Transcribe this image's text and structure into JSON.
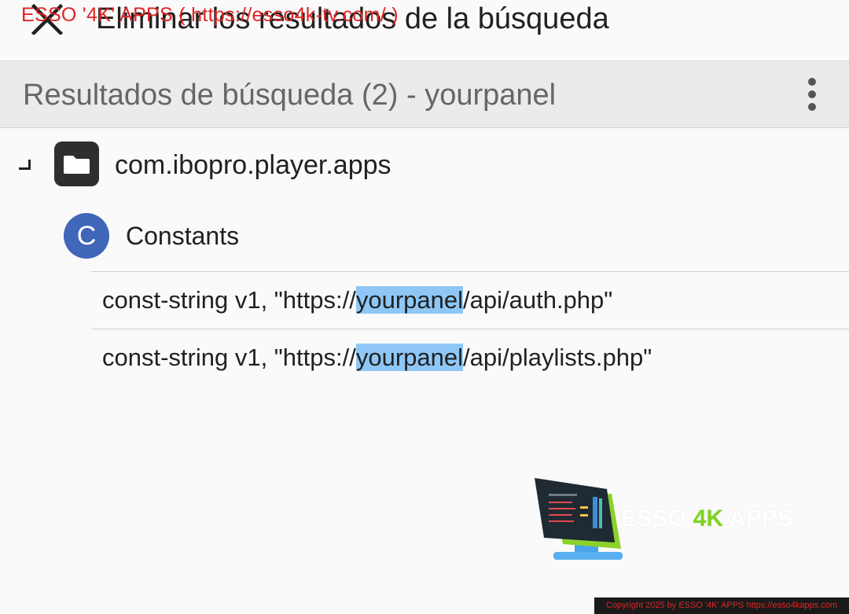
{
  "topbar": {
    "close_icon": "close-icon",
    "title": "Eliminar los resultados de la búsqueda",
    "watermark": "ESSO '4K' APPS ( https://esso4k-tv.com/ )"
  },
  "header": {
    "title": "Resultados de búsqueda (2) - yourpanel",
    "more_icon": "more-vert-icon"
  },
  "tree": {
    "package": {
      "expander_icon": "collapse-corner-icon",
      "icon": "folder-icon",
      "label": "com.ibopro.player.apps"
    },
    "class": {
      "badge": "C",
      "label": "Constants"
    },
    "results": [
      {
        "prefix": "const-string v1, \"https://",
        "match": "yourpanel",
        "suffix": "/api/auth.php\""
      },
      {
        "prefix": "const-string v1, \"https://",
        "match": "yourpanel",
        "suffix": "/api/playlists.php\""
      }
    ]
  },
  "watermark": {
    "logo_main": "ESSO ",
    "logo_accent": "4K",
    "logo_end": " APPS",
    "copyright": "Copyright 2025 by ESSO '4K' APPS https://esso4kapps.com"
  },
  "colors": {
    "background": "#fafafa",
    "header_background": "#ebebeb",
    "highlight": "#8ec7f6",
    "class_badge": "#3f66b8",
    "watermark_red": "#e02424",
    "logo_green": "#7ed321"
  }
}
